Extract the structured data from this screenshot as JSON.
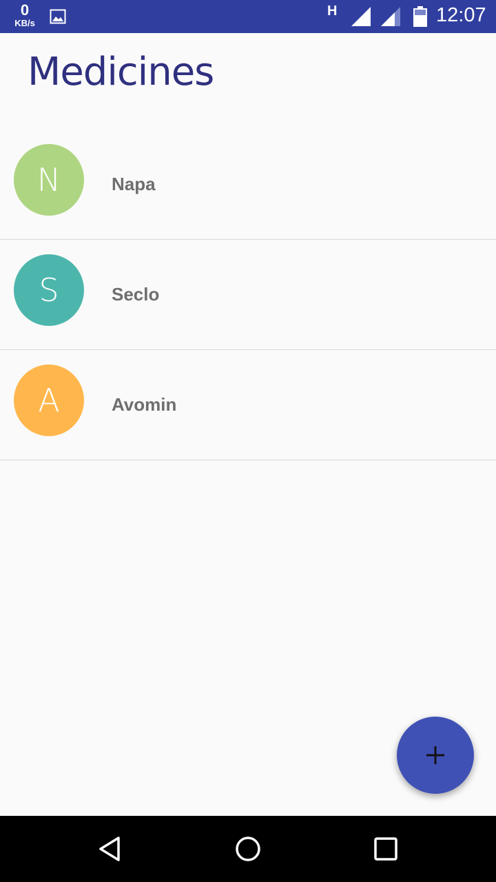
{
  "status_bar": {
    "speed_value": "0",
    "speed_unit": "KB/s",
    "network_type": "H",
    "time": "12:07",
    "icons": [
      "image-icon",
      "signal-icon",
      "signal-icon",
      "battery-icon"
    ]
  },
  "page": {
    "title": "Medicines"
  },
  "medicines": [
    {
      "initial": "N",
      "name": "Napa",
      "color": "#AED581"
    },
    {
      "initial": "S",
      "name": "Seclo",
      "color": "#4DB6AC"
    },
    {
      "initial": "A",
      "name": "Avomin",
      "color": "#FFB74D"
    }
  ],
  "fab": {
    "icon": "plus-icon",
    "color": "#3F51B5"
  },
  "nav_bar": {
    "icons": [
      "back-icon",
      "home-icon",
      "recents-icon"
    ]
  },
  "colors": {
    "status_bar": "#303F9F",
    "title": "#303080",
    "background": "#FAFAFA"
  }
}
